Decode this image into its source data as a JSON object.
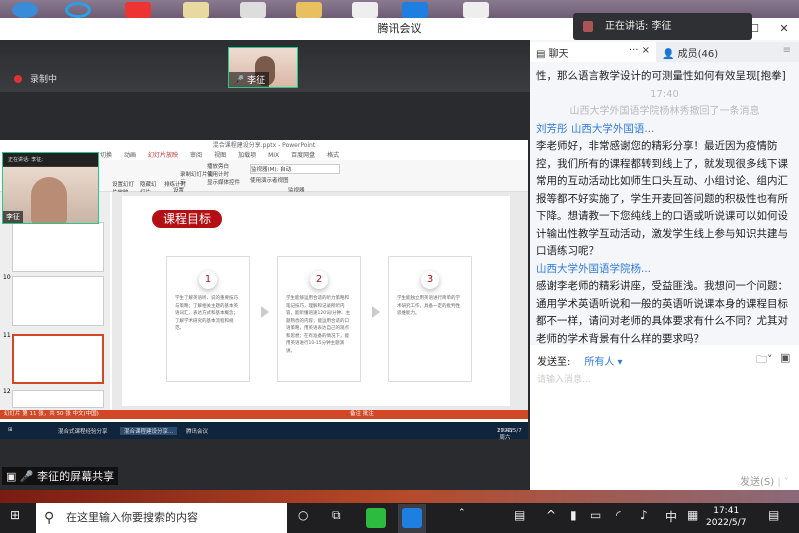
{
  "window": {
    "title": "腾讯会议",
    "recording": "录制中",
    "speaker_thumb": "李征",
    "speaking_toast": "正在讲话: 李征"
  },
  "share": {
    "label": "李征的屏幕共享",
    "ppt": {
      "title": "混合课程建设分享.pptx - PowerPoint",
      "tabs": [
        "切换",
        "动画",
        "幻灯片放映",
        "审阅",
        "视图",
        "加载项",
        "MIX",
        "百度网盘",
        "格式"
      ],
      "active_tab": "幻灯片放映",
      "ribbon": [
        "设置幻灯片放映",
        "隐藏幻灯片",
        "排练计时",
        "录制幻灯片演示",
        "播放旁白",
        "使用计时",
        "显示媒体控件",
        "监视器(M): 自动",
        "使用演示者视图",
        "设置",
        "监视器"
      ],
      "slide_numbers": [
        "10",
        "11",
        "12"
      ],
      "slide_title": "课程目标",
      "cards": [
        {
          "num": "1",
          "text": "学生了解英语听、说的重要技巧与策略；了解相关主题的基本英语词汇、表达方式和基本概念；了解学术研究的基本流程和规范。"
        },
        {
          "num": "2",
          "text": "学生能够运用合适的听力策略和笔记技巧，理解和记录所听内容，能听懂语速120词/分钟、主题熟悉的内容；能运用合适的口语策略，用英语表达自己的观点和思想；在有准备的情况下，能用英语进行10-15分钟主题演讲。"
        },
        {
          "num": "3",
          "text": "学生能独立用英语进行简单的学术研究工作，具备一定的批判性思维能力。"
        }
      ],
      "status": "幻灯片 第 11 张，共 50 张    中文(中国)",
      "status_right": "备注   批注"
    },
    "cam": {
      "speaking": "正在讲话: 李征;",
      "name": "李征"
    },
    "remote_taskbar": {
      "items": [
        "混合式课程经验分享",
        "混合课程建设分享...",
        "腾讯会议"
      ],
      "time": "17:41 周六",
      "date": "2022/5/7"
    }
  },
  "panel": {
    "tabs": {
      "chat": "聊天",
      "more": "··· ×",
      "members": "成员(46)"
    },
    "messages": [
      {
        "type": "text",
        "text": "性，那么语言教学设计的可测量性如何有效呈现[抱拳]"
      },
      {
        "type": "sys",
        "text": "17:40"
      },
      {
        "type": "sys",
        "text": "山西大学外国语学院杨林秀撤回了一条消息"
      },
      {
        "type": "sender",
        "text": "刘芳彤 山西大学外国语..."
      },
      {
        "type": "text",
        "text": "李老师好，非常感谢您的精彩分享！最近因为疫情防控，我们所有的课程都转到线上了，就发现很多线下课常用的互动活动比如师生口头互动、小组讨论、组内汇报等都不好实施了，学生开麦回答问题的积极性也有所下降。想请教一下您纯线上的口语或听说课可以如何设计输出性教学互动活动，激发学生线上参与知识共建与口语练习呢？"
      },
      {
        "type": "sender",
        "text": "山西大学外国语学院杨..."
      },
      {
        "type": "text",
        "text": "感谢李老师的精彩讲座，受益匪浅。我想问一个问题：通用学术英语听说和一般的英语听说课本身的课程目标都不一样，请问对老师的具体要求有什么不同？尤其对老师的学术背景有什么样的要求吗？"
      }
    ],
    "send_to_label": "发送至:",
    "send_to_value": "所有人 ▾",
    "placeholder": "请输入消息...",
    "send_button": "发送(S)"
  },
  "taskbar": {
    "search_placeholder": "在这里输入你要搜索的内容",
    "ime": "中",
    "time": "17:41",
    "date": "2022/5/7"
  },
  "colors": {
    "accent": "#2f7bde",
    "slide_red": "#b30f14",
    "ppt_orange": "#d24726"
  }
}
